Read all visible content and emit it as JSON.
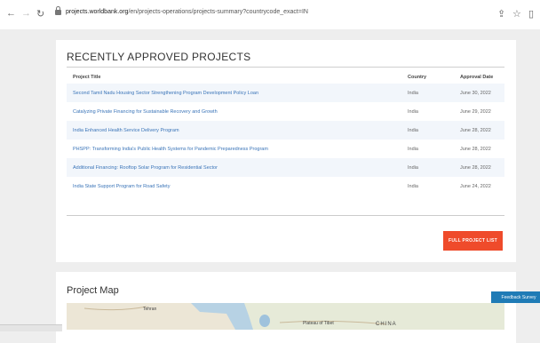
{
  "browser": {
    "url_host": "projects.worldbank.org",
    "url_path": "/en/projects-operations/projects-summary?countrycode_exact=IN",
    "back_glyph": "←",
    "forward_glyph": "→",
    "reload_glyph": "↻",
    "share_glyph": "⇪",
    "star_glyph": "☆",
    "sidepanel_glyph": "▯"
  },
  "section": {
    "title": "RECENTLY APPROVED PROJECTS",
    "columns": {
      "title": "Project Title",
      "country": "Country",
      "date": "Approval Date"
    },
    "rows": [
      {
        "title": "Second Tamil Nadu Housing Sector Strengthening Program Development Policy Loan",
        "country": "India",
        "date": "June 30, 2022"
      },
      {
        "title": "Catalyzing Private Financing for Sustainable Recovery and Growth",
        "country": "India",
        "date": "June 29, 2022"
      },
      {
        "title": "India Enhanced Health Service Delivery Program",
        "country": "India",
        "date": "June 28, 2022"
      },
      {
        "title": "PHSPP: Transforming India's Public Health Systems for Pandemic Preparedness Program",
        "country": "India",
        "date": "June 28, 2022"
      },
      {
        "title": "Additional Financing: Rooftop Solar Program for Residential Sector",
        "country": "India",
        "date": "June 28, 2022"
      },
      {
        "title": "India State Support Program for Road Safety",
        "country": "India",
        "date": "June 24, 2022"
      }
    ],
    "full_list_button": "FULL PROJECT LIST"
  },
  "map": {
    "title": "Project Map",
    "labels": [
      "Tehran",
      "Plateau of Tibet",
      "CHINA"
    ]
  },
  "feedback_label": "Feedback Survey",
  "colors": {
    "accent_button": "#ef4b2b",
    "link": "#3a74b8",
    "feedback": "#1f7bb6",
    "map_water": "#b7d2e4"
  }
}
